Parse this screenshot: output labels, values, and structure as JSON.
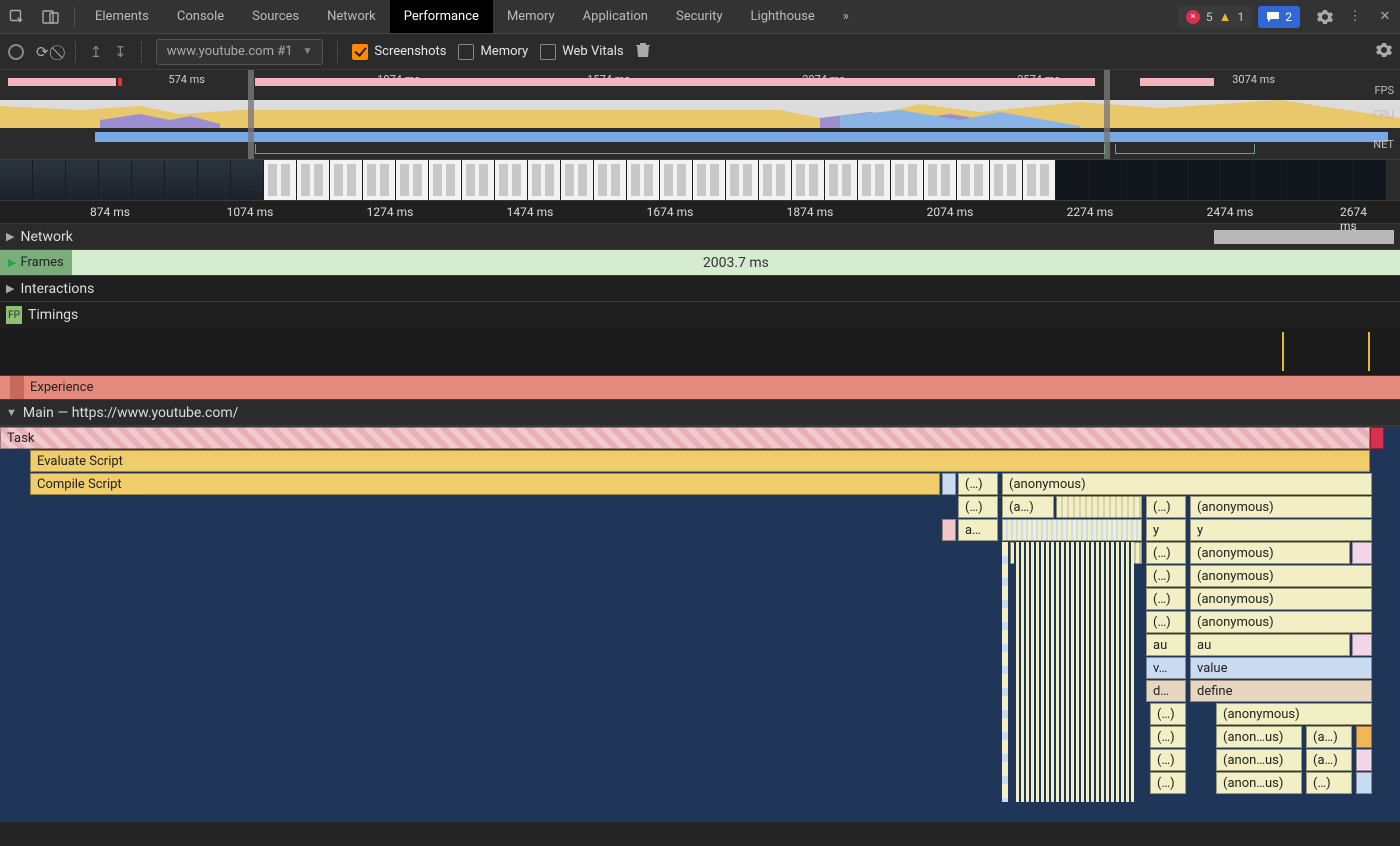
{
  "tabs": [
    "Elements",
    "Console",
    "Sources",
    "Network",
    "Performance",
    "Memory",
    "Application",
    "Security",
    "Lighthouse"
  ],
  "active_tab": "Performance",
  "error_badge": {
    "errors": "5",
    "warnings": "1"
  },
  "messages_badge": "2",
  "toolbar": {
    "recording_label": "www.youtube.com #1",
    "screenshots": "Screenshots",
    "memory": "Memory",
    "webvitals": "Web Vitals"
  },
  "overview_ticks": [
    "574 ms",
    "1074 ms",
    "1574 ms",
    "2074 ms",
    "2574 ms",
    "3074 ms"
  ],
  "overview_labels": {
    "fps": "FPS",
    "cpu": "CPU",
    "net": "NET"
  },
  "ruler_ticks": [
    "874 ms",
    "1074 ms",
    "1274 ms",
    "1474 ms",
    "1674 ms",
    "1874 ms",
    "2074 ms",
    "2274 ms",
    "2474 ms",
    "2674 ms"
  ],
  "tracks": {
    "network": "Network",
    "frames": "Frames",
    "frames_value": "2003.7 ms",
    "interactions": "Interactions",
    "timings": "Timings",
    "fp": "FP",
    "experience": "Experience",
    "main": "Main — https://www.youtube.com/"
  },
  "flame": {
    "task": "Task",
    "eval": "Evaluate Script",
    "compile": "Compile Script",
    "ellip": "(…)",
    "anon": "(anonymous)",
    "anon_trunc": "(anon…us)",
    "a": "(a…)",
    "ashort": "a…",
    "y": "y",
    "au": "au",
    "v": "v…",
    "value": "value",
    "d": "d…",
    "define": "define"
  }
}
